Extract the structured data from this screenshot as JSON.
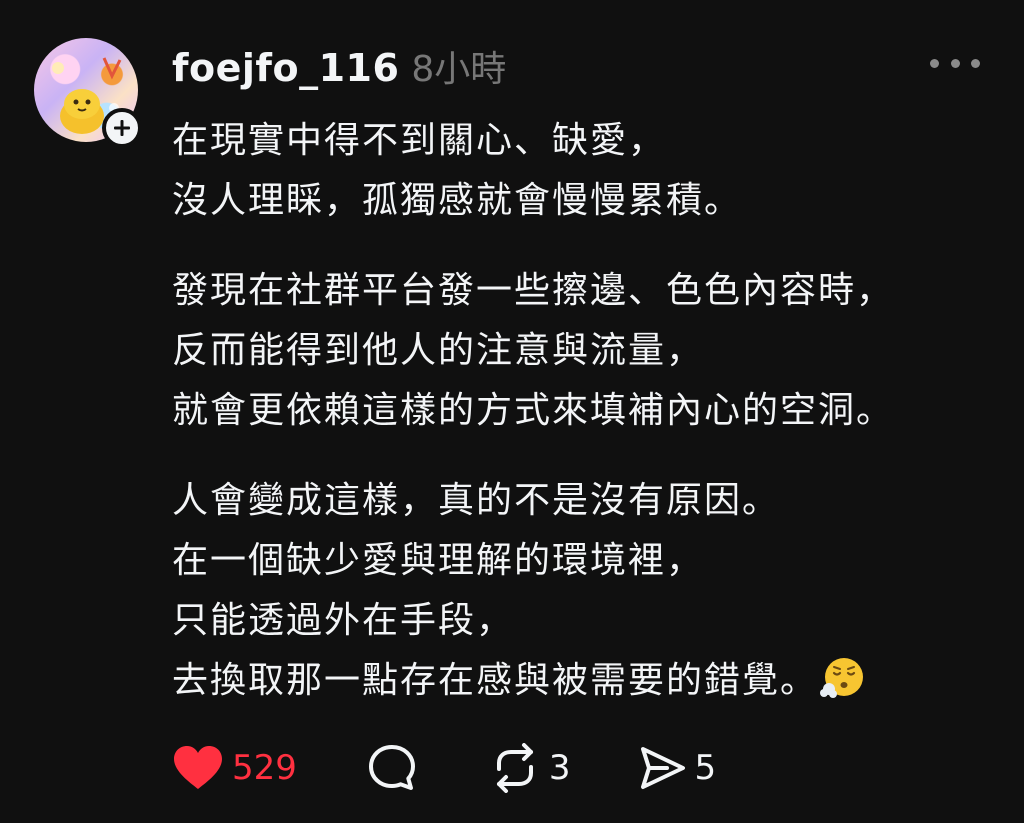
{
  "post": {
    "author": {
      "username": "foejfo_116",
      "avatar_icon": "avatar-image"
    },
    "timestamp": "8小時",
    "paragraphs": [
      [
        "在現實中得不到關心、缺愛，",
        "沒人理睬，孤獨感就會慢慢累積。"
      ],
      [
        "發現在社群平台發一些擦邊、色色內容時，",
        "反而能得到他人的注意與流量，",
        "就會更依賴這樣的方式來填補內心的空洞。"
      ],
      [
        "人會變成這樣，真的不是沒有原因。",
        "在一個缺少愛與理解的環境裡，",
        "只能透過外在手段，",
        "去換取那一點存在感與被需要的錯覺。"
      ]
    ],
    "trailing_emoji": "face-exhaling-emoji",
    "actions": {
      "likes": "529",
      "replies": "",
      "reposts": "3",
      "shares": "5"
    }
  },
  "colors": {
    "background": "#101010",
    "text": "#f3f5f7",
    "muted": "#777777",
    "like_red": "#ff3040"
  }
}
